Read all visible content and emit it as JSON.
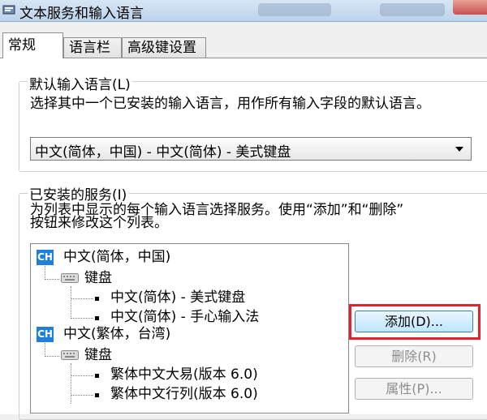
{
  "window": {
    "title": "文本服务和输入语言"
  },
  "tabs": [
    {
      "label": "常规",
      "active": true
    },
    {
      "label": "语言栏",
      "active": false
    },
    {
      "label": "高级键设置",
      "active": false
    }
  ],
  "default_language": {
    "legend": "默认输入语言(L)",
    "description": "选择其中一个已安装的输入语言，用作所有输入字段的默认语言。",
    "selected": "中文(简体，中国) - 中文(简体) - 美式键盘"
  },
  "installed_services": {
    "legend": "已安装的服务(I)",
    "description_line1": "为列表中显示的每个输入语言选择服务。使用“添加”和“删除”",
    "description_line2": "按钮来修改这个列表。",
    "tree": {
      "lang1": {
        "badge": "CH",
        "label": "中文(简体，中国)"
      },
      "lang1_keyboard": "键盘",
      "lang1_items": [
        "中文(简体) - 美式键盘",
        "中文(简体) - 手心输入法"
      ],
      "lang2": {
        "badge": "CH",
        "label": "中文(繁体，台湾)"
      },
      "lang2_keyboard": "键盘",
      "lang2_items": [
        "繁体中文大易(版本 6.0)",
        "繁体中文行列(版本 6.0)"
      ]
    },
    "buttons": {
      "add": "添加(D)...",
      "remove": "删除(R)",
      "properties": "属性(P)..."
    }
  },
  "colors": {
    "highlight": "#e8202a",
    "badge": "#1f7fdc"
  }
}
